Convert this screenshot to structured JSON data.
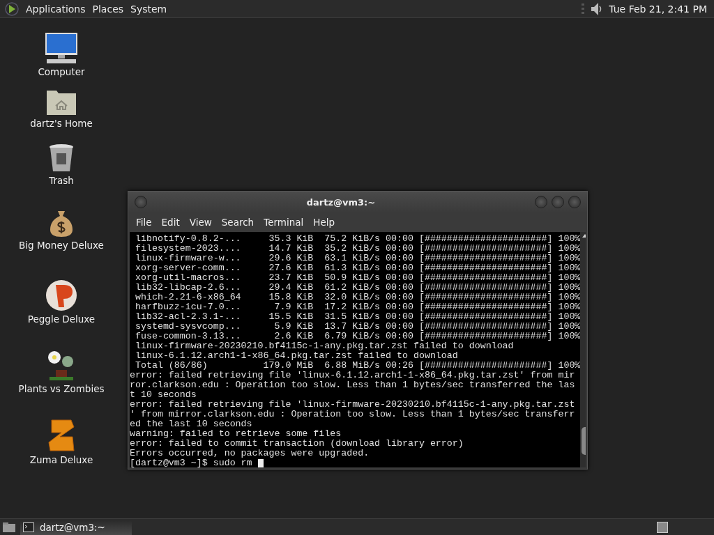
{
  "top_panel": {
    "menus": [
      "Applications",
      "Places",
      "System"
    ],
    "clock": "Tue Feb 21,  2:41 PM"
  },
  "desktop_icons": [
    {
      "kind": "computer",
      "label": "Computer"
    },
    {
      "kind": "home",
      "label": "dartz's Home"
    },
    {
      "kind": "trash",
      "label": "Trash"
    },
    {
      "kind": "money",
      "label": "Big Money Deluxe"
    },
    {
      "kind": "peggle",
      "label": "Peggle Deluxe"
    },
    {
      "kind": "plant",
      "label": "Plants vs Zombies"
    },
    {
      "kind": "zuma",
      "label": "Zuma Deluxe"
    }
  ],
  "terminal": {
    "title": "dartz@vm3:~",
    "menu": [
      "File",
      "Edit",
      "View",
      "Search",
      "Terminal",
      "Help"
    ],
    "lines": [
      " libnotify-0.8.2-...     35.3 KiB  75.2 KiB/s 00:00 [######################] 100%",
      " filesystem-2023....     14.7 KiB  35.2 KiB/s 00:00 [######################] 100%",
      " linux-firmware-w...     29.6 KiB  63.1 KiB/s 00:00 [######################] 100%",
      " xorg-server-comm...     27.6 KiB  61.3 KiB/s 00:00 [######################] 100%",
      " xorg-util-macros...     23.7 KiB  50.9 KiB/s 00:00 [######################] 100%",
      " lib32-libcap-2.6...     29.4 KiB  61.2 KiB/s 00:00 [######################] 100%",
      " which-2.21-6-x86_64     15.8 KiB  32.0 KiB/s 00:00 [######################] 100%",
      " harfbuzz-icu-7.0...      7.9 KiB  17.2 KiB/s 00:00 [######################] 100%",
      " lib32-acl-2.3.1-...     15.5 KiB  31.5 KiB/s 00:00 [######################] 100%",
      " systemd-sysvcomp...      5.9 KiB  13.7 KiB/s 00:00 [######################] 100%",
      " fuse-common-3.13...      2.6 KiB  6.79 KiB/s 00:00 [######################] 100%",
      " linux-firmware-20230210.bf4115c-1-any.pkg.tar.zst failed to download",
      " linux-6.1.12.arch1-1-x86_64.pkg.tar.zst failed to download",
      " Total (86/86)          179.0 MiB  6.88 MiB/s 00:26 [######################] 100%",
      "error: failed retrieving file 'linux-6.1.12.arch1-1-x86_64.pkg.tar.zst' from mir",
      "ror.clarkson.edu : Operation too slow. Less than 1 bytes/sec transferred the las",
      "t 10 seconds",
      "error: failed retrieving file 'linux-firmware-20230210.bf4115c-1-any.pkg.tar.zst",
      "' from mirror.clarkson.edu : Operation too slow. Less than 1 bytes/sec transferr",
      "ed the last 10 seconds",
      "warning: failed to retrieve some files",
      "error: failed to commit transaction (download library error)",
      "Errors occurred, no packages were upgraded.",
      "[dartz@vm3 ~]$ sudo rm "
    ]
  },
  "taskbar": {
    "tasks": [
      {
        "label": "dartz@vm3:~",
        "selected": false
      }
    ]
  }
}
